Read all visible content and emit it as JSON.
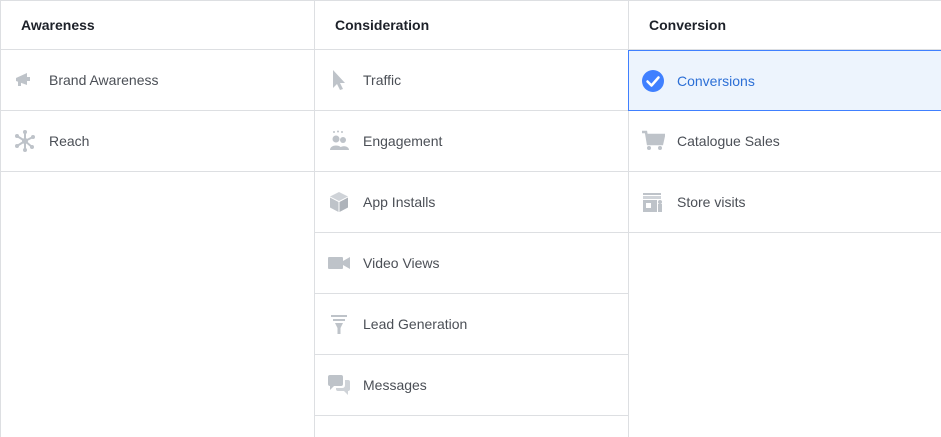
{
  "columns": {
    "awareness": {
      "title": "Awareness",
      "items": [
        {
          "label": "Brand Awareness",
          "icon": "megaphone-icon"
        },
        {
          "label": "Reach",
          "icon": "reach-icon"
        }
      ]
    },
    "consideration": {
      "title": "Consideration",
      "items": [
        {
          "label": "Traffic",
          "icon": "cursor-icon"
        },
        {
          "label": "Engagement",
          "icon": "people-icon"
        },
        {
          "label": "App Installs",
          "icon": "box-icon"
        },
        {
          "label": "Video Views",
          "icon": "video-camera-icon"
        },
        {
          "label": "Lead Generation",
          "icon": "funnel-icon"
        },
        {
          "label": "Messages",
          "icon": "chat-bubbles-icon"
        }
      ]
    },
    "conversion": {
      "title": "Conversion",
      "items": [
        {
          "label": "Conversions",
          "icon": "checkmark-circle-icon",
          "selected": true
        },
        {
          "label": "Catalogue Sales",
          "icon": "shopping-cart-icon"
        },
        {
          "label": "Store visits",
          "icon": "store-icon"
        }
      ]
    }
  },
  "colors": {
    "selected_bg": "#edf4fd",
    "selected_border": "#4080ff",
    "selected_text": "#2c6fd6",
    "icon_gray": "#bec3c9",
    "divider": "#dddfe2"
  }
}
